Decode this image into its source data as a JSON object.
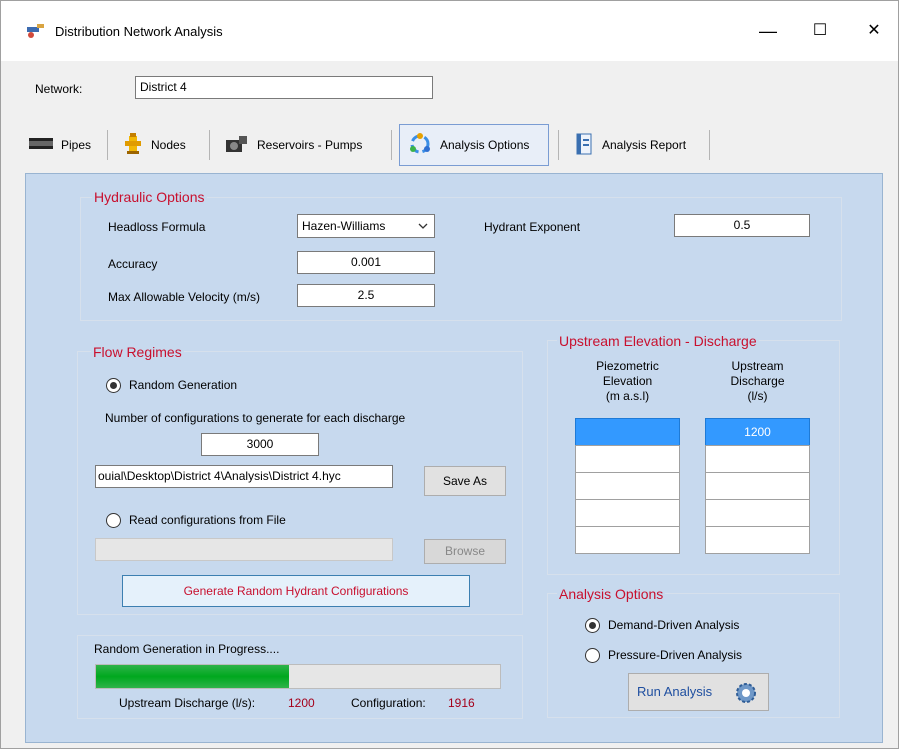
{
  "window": {
    "title": "Distribution Network Analysis",
    "minimize": "—",
    "maximize": "☐",
    "close": "✕"
  },
  "network": {
    "label": "Network:",
    "value": "District 4"
  },
  "tabs": [
    {
      "label": "Pipes",
      "icon": "pipe-icon"
    },
    {
      "label": "Nodes",
      "icon": "hydrant-icon"
    },
    {
      "label": "Reservoirs - Pumps",
      "icon": "pump-icon"
    },
    {
      "label": "Analysis Options",
      "icon": "analysis-options-icon",
      "active": true
    },
    {
      "label": "Analysis Report",
      "icon": "report-icon"
    }
  ],
  "hydraulic": {
    "title": "Hydraulic Options",
    "headloss_label": "Headloss Formula",
    "headloss_value": "Hazen-Williams",
    "hydrant_exp_label": "Hydrant Exponent",
    "hydrant_exp_value": "0.5",
    "accuracy_label": "Accuracy",
    "accuracy_value": "0.001",
    "velocity_label": "Max Allowable Velocity (m/s)",
    "velocity_value": "2.5"
  },
  "flow": {
    "title": "Flow Regimes",
    "random_label": "Random Generation",
    "num_config_label": "Number of configurations to generate for each discharge",
    "num_config_value": "3000",
    "path_value": "ouial\\Desktop\\District 4\\Analysis\\District 4.hyc",
    "save_as": "Save As",
    "read_label": "Read configurations from File",
    "file_value": "",
    "browse": "Browse",
    "generate": "Generate Random Hydrant Configurations"
  },
  "upstream": {
    "title": "Upstream Elevation - Discharge",
    "col1": [
      "Piezometric",
      "Elevation",
      "(m a.s.l)"
    ],
    "col2": [
      "Upstream",
      "Discharge",
      "(l/s)"
    ],
    "rows": [
      {
        "elevation": "",
        "discharge": "1200"
      },
      {
        "elevation": "",
        "discharge": ""
      },
      {
        "elevation": "",
        "discharge": ""
      },
      {
        "elevation": "",
        "discharge": ""
      },
      {
        "elevation": "",
        "discharge": ""
      }
    ]
  },
  "analysis": {
    "title": "Analysis Options",
    "demand_label": "Demand-Driven Analysis",
    "pressure_label": "Pressure-Driven Analysis",
    "run": "Run Analysis"
  },
  "progress": {
    "title": "Random Generation in Progress....",
    "fraction": 0.477,
    "discharge_label": "Upstream Discharge (l/s):",
    "discharge_value": "1200",
    "config_label": "Configuration:",
    "config_value": "1916"
  },
  "colors": {
    "accent_red": "#c8102e",
    "panel_bg": "#c7d9ee",
    "progress_green": "#00a81e",
    "selection_blue": "#3399ff"
  }
}
